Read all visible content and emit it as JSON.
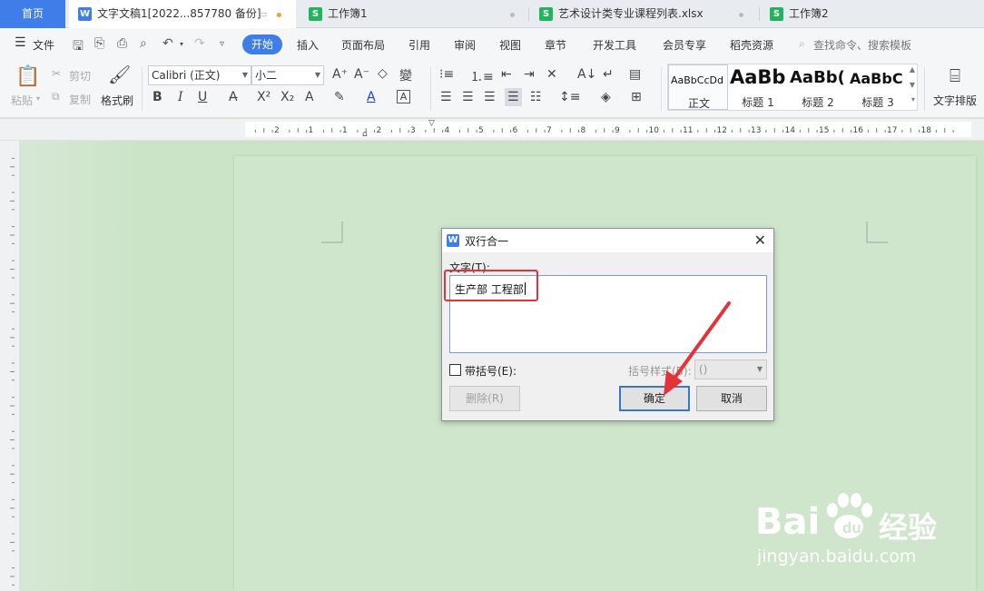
{
  "tabs": {
    "home": "首页",
    "items": [
      {
        "label": "文字文稿1[2022...857780 备份]",
        "icon": "W",
        "active": true
      },
      {
        "label": "工作簿1",
        "icon": "S",
        "active": false
      },
      {
        "label": "艺术设计类专业课程列表.xlsx",
        "icon": "S",
        "active": false
      },
      {
        "label": "工作簿2",
        "icon": "S",
        "active": false
      }
    ]
  },
  "menubar": {
    "file": "文件",
    "items": [
      "开始",
      "插入",
      "页面布局",
      "引用",
      "审阅",
      "视图",
      "章节",
      "开发工具",
      "会员专享",
      "稻壳资源"
    ],
    "search": "查找命令、搜索模板"
  },
  "ribbon": {
    "paste": "粘贴",
    "cut": "剪切",
    "copy": "复制",
    "format_painter": "格式刷",
    "font_name": "Calibri (正文)",
    "font_size": "小二",
    "styles": [
      {
        "sample": "AaBbCcDd",
        "name": "正文"
      },
      {
        "sample": "AaBb",
        "name": "标题 1"
      },
      {
        "sample": "AaBb(",
        "name": "标题 2"
      },
      {
        "sample": "AaBbC",
        "name": "标题 3"
      }
    ],
    "text_layout": "文字排版"
  },
  "ruler_numbers": [
    "2",
    "1",
    "1",
    "2",
    "3",
    "4",
    "5",
    "6",
    "7",
    "8",
    "9",
    "10",
    "11",
    "12",
    "13",
    "14",
    "15",
    "16",
    "17",
    "18"
  ],
  "dialog": {
    "title": "双行合一",
    "text_label": "文字(T):",
    "text_value": "生产部 工程部",
    "bracket_checkbox_label": "带括号(E):",
    "bracket_style_label": "括号样式(B):",
    "bracket_style_value": "()",
    "delete_button": "删除(R)",
    "ok_button": "确定",
    "cancel_button": "取消"
  },
  "watermark": {
    "brand": "Bai",
    "brand_suffix": "经验",
    "url": "jingyan.baidu.com"
  },
  "colors": {
    "accent": "#3f7ee8",
    "wps_green": "#22b35e",
    "annotation_red": "#e5323a",
    "page_bg": "#cfe6cc"
  }
}
